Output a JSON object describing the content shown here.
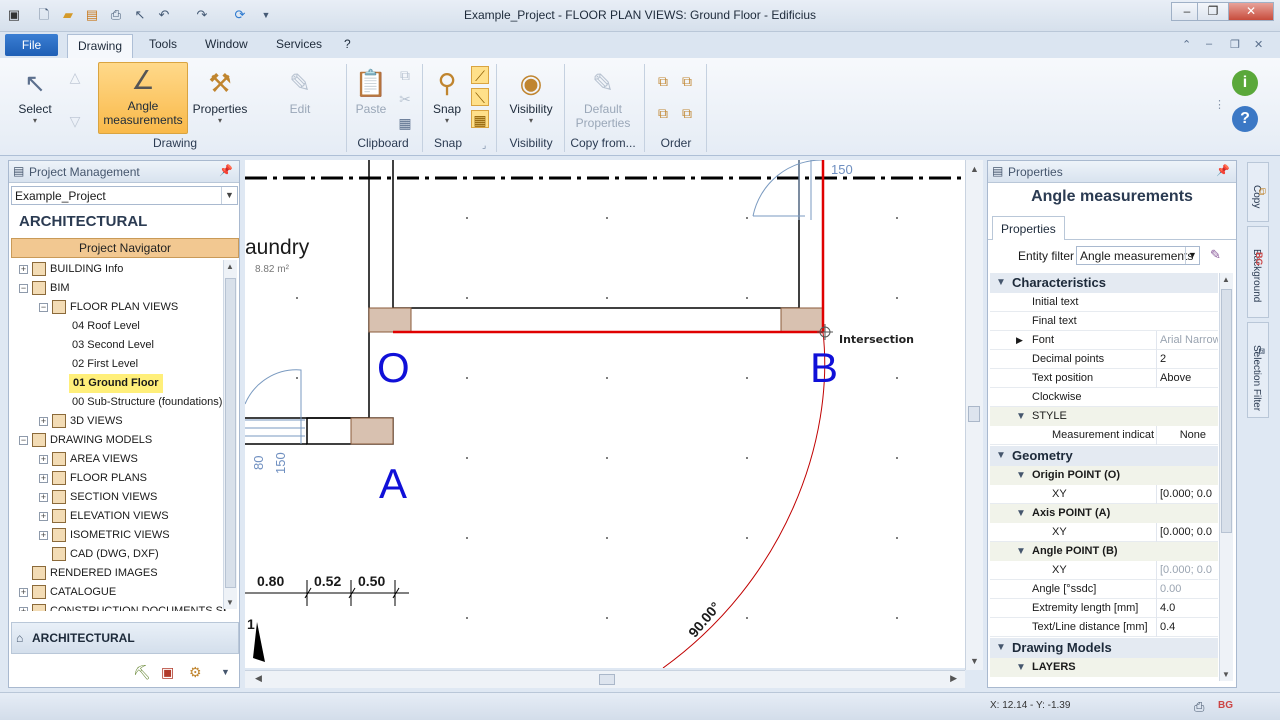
{
  "window": {
    "title": "Example_Project -  FLOOR PLAN VIEWS: Ground Floor - Edificius"
  },
  "menu": {
    "file": "File",
    "tabs": [
      "Drawing",
      "Tools",
      "Window",
      "Services",
      "?"
    ]
  },
  "ribbon": {
    "select": "Select",
    "angle": "Angle measurements",
    "properties": "Properties",
    "edit": "Edit",
    "paste": "Paste",
    "snap": "Snap",
    "visibility": "Visibility",
    "default_properties": "Default Properties",
    "groups": {
      "drawing": "Drawing",
      "clipboard": "Clipboard",
      "snap": "Snap",
      "visibility": "Visibility",
      "copy_from": "Copy from...",
      "order": "Order"
    }
  },
  "left_panel": {
    "title": "Project Management",
    "project": "Example_Project",
    "section": "ARCHITECTURAL",
    "navigator": "Project Navigator",
    "tree": [
      {
        "label": "BUILDING Info",
        "level": 0,
        "exp": "+"
      },
      {
        "label": "BIM",
        "level": 0,
        "exp": "−"
      },
      {
        "label": "FLOOR PLAN VIEWS",
        "level": 1,
        "exp": "−"
      },
      {
        "label": "04 Roof Level",
        "level": 2
      },
      {
        "label": "03 Second Level",
        "level": 2
      },
      {
        "label": "02 First Level",
        "level": 2
      },
      {
        "label": "01 Ground Floor",
        "level": 2,
        "current": true
      },
      {
        "label": "00 Sub-Structure (foundations)",
        "level": 2
      },
      {
        "label": "3D VIEWS",
        "level": 1,
        "exp": "+"
      },
      {
        "label": "DRAWING MODELS",
        "level": 0,
        "exp": "−"
      },
      {
        "label": "AREA VIEWS",
        "level": 1,
        "exp": "+"
      },
      {
        "label": "FLOOR PLANS",
        "level": 1,
        "exp": "+"
      },
      {
        "label": "SECTION VIEWS",
        "level": 1,
        "exp": "+"
      },
      {
        "label": "ELEVATION VIEWS",
        "level": 1,
        "exp": "+"
      },
      {
        "label": "ISOMETRIC VIEWS",
        "level": 1,
        "exp": "+"
      },
      {
        "label": "CAD (DWG, DXF)",
        "level": 1
      },
      {
        "label": "RENDERED IMAGES",
        "level": 0
      },
      {
        "label": "CATALOGUE",
        "level": 0,
        "exp": "+"
      },
      {
        "label": "CONSTRUCTION DOCUMENTS SET",
        "level": 0,
        "exp": "+"
      }
    ],
    "bottom_section": "ARCHITECTURAL"
  },
  "drawing": {
    "room_name": "aundry",
    "room_area": "8.82 m²",
    "label_o": "O",
    "label_a": "A",
    "label_b": "B",
    "snap_label": "Intersection",
    "angle_text": "90.00°",
    "dim_150_top": "150",
    "dim_80": "80",
    "dim_150_left": "150",
    "dims": [
      "0.80",
      "0.52",
      "0.50"
    ],
    "dim_partial": "1"
  },
  "properties": {
    "panel_title": "Properties",
    "heading": "Angle measurements",
    "tab": "Properties",
    "entity_filter_label": "Entity filter",
    "entity_filter_value": "Angle measurements",
    "cat_characteristics": "Characteristics",
    "initial_text": "Initial text",
    "final_text": "Final text",
    "font": "Font",
    "font_value": "Arial Narrow",
    "decimal_points": "Decimal points",
    "decimal_points_value": "2",
    "text_position": "Text position",
    "text_position_value": "Above",
    "clockwise": "Clockwise",
    "style": "STYLE",
    "measurement_indicator": "Measurement indicat",
    "measurement_indicator_value": "None",
    "cat_geometry": "Geometry",
    "origin_point": "Origin POINT (O)",
    "axis_point": "Axis POINT (A)",
    "angle_point": "Angle POINT (B)",
    "xy": "XY",
    "xy_value": "[0.000; 0.0",
    "angle": "Angle  [°ssdc]",
    "angle_value": "0.00",
    "extremity_length": "Extremity length  [mm]",
    "extremity_length_value": "4.0",
    "text_line_distance": "Text/Line distance  [mm]",
    "text_line_distance_value": "0.4",
    "cat_drawing_models": "Drawing Models",
    "layers": "LAYERS"
  },
  "side_tabs": [
    "Copy",
    "Background",
    "Selection Filter"
  ],
  "status": {
    "coords": "X: 12.14 - Y: -1.39"
  }
}
